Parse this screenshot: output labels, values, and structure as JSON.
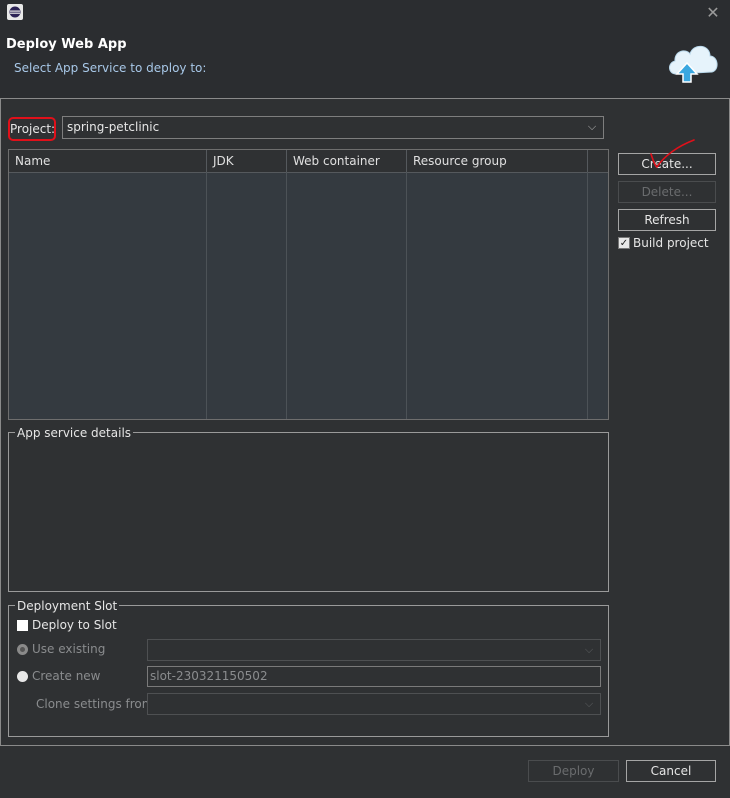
{
  "window": {
    "app_icon": "eclipse-icon",
    "close_icon": "close-icon"
  },
  "header": {
    "title": "Deploy Web App",
    "subtitle": "Select App Service to deploy to:",
    "banner_icon": "cloud-upload-icon"
  },
  "project": {
    "label": "Project:",
    "value": "spring-petclinic"
  },
  "table": {
    "columns": [
      "Name",
      "JDK",
      "Web container",
      "Resource group"
    ],
    "rows": []
  },
  "actions": {
    "create_label": "Create...",
    "delete_label": "Delete...",
    "refresh_label": "Refresh",
    "build_project_label": "Build project",
    "build_project_checked": true
  },
  "details": {
    "legend": "App service details"
  },
  "slot": {
    "legend": "Deployment Slot",
    "deploy_to_slot_label": "Deploy to Slot",
    "deploy_to_slot_checked": false,
    "use_existing_label": "Use existing",
    "create_new_label": "Create new",
    "create_new_value": "slot-230321150502",
    "clone_label": "Clone settings from"
  },
  "footer": {
    "deploy_label": "Deploy",
    "cancel_label": "Cancel"
  },
  "colors": {
    "background": "#2f3133",
    "highlight_annotation": "#e0101a",
    "subtitle": "#a8c8e8"
  }
}
